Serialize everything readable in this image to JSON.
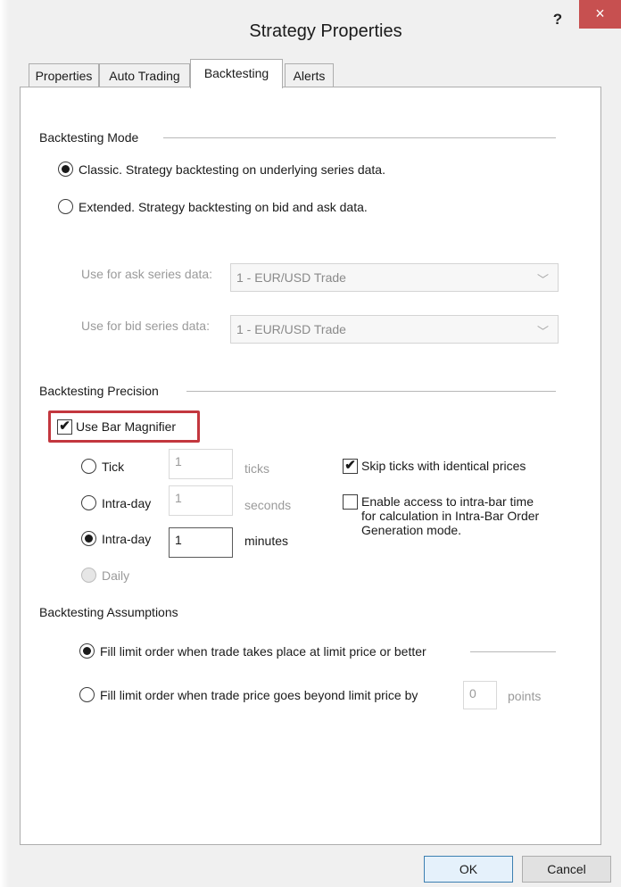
{
  "window": {
    "title": "Strategy Properties",
    "help_label": "?",
    "close_label": "×"
  },
  "tabs": [
    {
      "label": "Properties"
    },
    {
      "label": "Auto Trading"
    },
    {
      "label": "Backtesting",
      "active": true
    },
    {
      "label": "Alerts"
    }
  ],
  "mode": {
    "section_label": "Backtesting Mode",
    "classic_label": "Classic. Strategy backtesting on underlying series data.",
    "classic_selected": true,
    "extended_label": "Extended. Strategy backtesting on bid and ask data.",
    "extended_selected": false,
    "ask_label": "Use for ask series data:",
    "ask_value": "1 - EUR/USD Trade",
    "bid_label": "Use for bid series data:",
    "bid_value": "1 - EUR/USD Trade"
  },
  "precision": {
    "section_label": "Backtesting Precision",
    "bar_magnifier_label": "Use Bar Magnifier",
    "bar_magnifier_checked": true,
    "tick_label": "Tick",
    "tick_value": "1",
    "tick_unit": "ticks",
    "intraday_seconds_label": "Intra-day",
    "intraday_seconds_value": "1",
    "intraday_seconds_unit": "seconds",
    "intraday_minutes_label": "Intra-day",
    "intraday_minutes_value": "1",
    "intraday_minutes_unit": "minutes",
    "intraday_minutes_selected": true,
    "daily_label": "Daily",
    "skip_ticks_label": "Skip ticks with identical prices",
    "skip_ticks_checked": true,
    "intrabar_line1": "Enable access to intra-bar time",
    "intrabar_line2": "for calculation in Intra-Bar Order",
    "intrabar_line3": "Generation mode.",
    "intrabar_checked": false
  },
  "assumptions": {
    "section_label": "Backtesting Assumptions",
    "fill_limit_label": "Fill limit order when trade takes place at limit price or better",
    "fill_limit_selected": true,
    "fill_beyond_label": "Fill limit order when trade price goes beyond limit price by",
    "fill_beyond_value": "0",
    "fill_beyond_unit": "points"
  },
  "buttons": {
    "ok_label": "OK",
    "cancel_label": "Cancel"
  },
  "colors": {
    "highlight": "#c3373e",
    "close_button": "#c75050"
  }
}
